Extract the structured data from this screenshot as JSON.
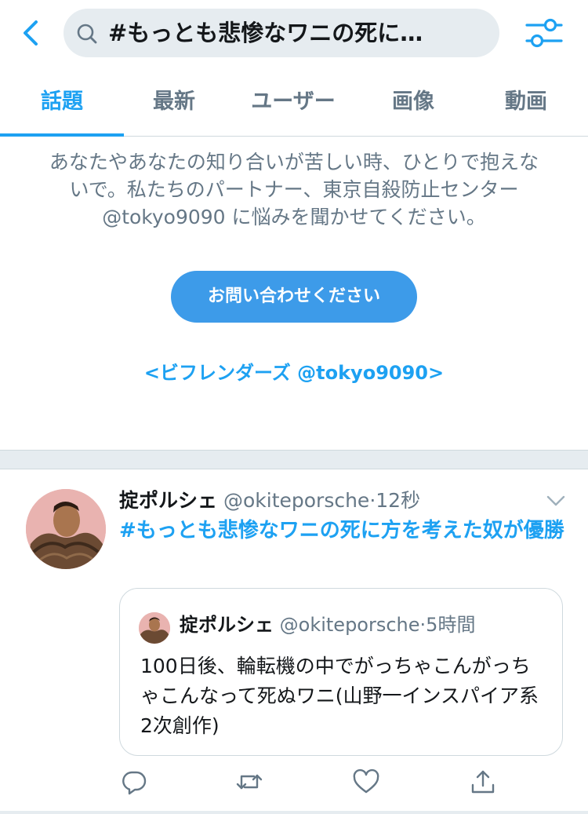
{
  "search": {
    "query": "#もっとも悲惨なワニの死に…"
  },
  "tabs": [
    {
      "label": "話題"
    },
    {
      "label": "最新"
    },
    {
      "label": "ユーザー"
    },
    {
      "label": "画像"
    },
    {
      "label": "動画"
    }
  ],
  "notice": {
    "text": "あなたやあなたの知り合いが苦しい時、ひとりで抱えないで。私たちのパートナー、東京自殺防止センター @tokyo9090 に悩みを聞かせてください。",
    "button_label": "お問い合わせください",
    "link_text": "<ビフレンダーズ @tokyo9090>"
  },
  "tweet": {
    "name": "掟ポルシェ",
    "handle": "@okiteporsche",
    "dot": "·",
    "time": "12秒",
    "body": "#もっとも悲惨なワニの死に方を考えた奴が優勝",
    "quote": {
      "name": "掟ポルシェ",
      "handle": "@okiteporsche",
      "dot": "·",
      "time": "5時間",
      "body": "100日後、輪転機の中でがっちゃこんがっちゃこんなって死ぬワニ(山野一インスパイア系2次創作)"
    }
  },
  "icons": {
    "back": "chevron-left-icon",
    "search": "search-icon",
    "filter": "sliders-icon",
    "caret": "chevron-down-icon",
    "reply": "reply-icon",
    "retweet": "retweet-icon",
    "like": "heart-icon",
    "share": "share-icon"
  },
  "colors": {
    "accent": "#1da1f2",
    "button": "#3d9be9",
    "secondary_text": "#657786",
    "search_bg": "#e6ecf0"
  }
}
